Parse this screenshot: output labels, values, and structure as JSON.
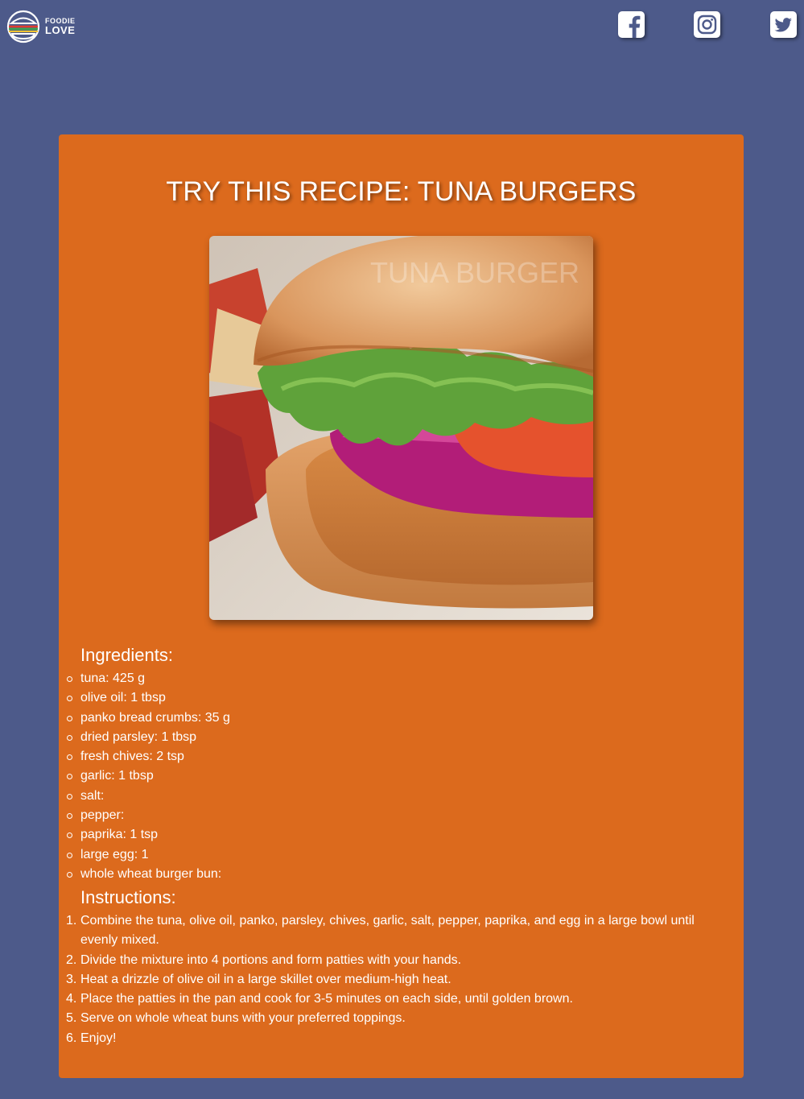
{
  "header": {
    "logo_top": "FOODIE",
    "logo_bottom": "LOVE",
    "social": [
      {
        "name": "facebook",
        "icon": "facebook-icon"
      },
      {
        "name": "instagram",
        "icon": "instagram-icon"
      },
      {
        "name": "twitter",
        "icon": "twitter-icon"
      }
    ]
  },
  "colors": {
    "background": "#4d5a8a",
    "card": "#dc6a1d",
    "text": "#ffffff"
  },
  "recipe": {
    "title": "TRY THIS RECIPE: TUNA BURGERS",
    "image_watermark": "TUNA BURGER",
    "ingredients_heading": "Ingredients:",
    "ingredients": [
      "tuna: 425 g",
      "olive oil: 1 tbsp",
      "panko bread crumbs: 35 g",
      "dried parsley: 1 tbsp",
      "fresh chives: 2 tsp",
      "garlic: 1 tbsp",
      "salt:",
      "pepper:",
      "paprika: 1 tsp",
      "large egg: 1",
      "whole wheat burger bun:"
    ],
    "instructions_heading": "Instructions:",
    "instructions": [
      "Combine the tuna, olive oil, panko, parsley, chives, garlic, salt, pepper, paprika, and egg in a large bowl until evenly mixed.",
      "Divide the mixture into 4 portions and form patties with your hands.",
      "Heat a drizzle of olive oil in a large skillet over medium-high heat.",
      "Place the patties in the pan and cook for 3-5 minutes on each side, until golden brown.",
      "Serve on whole wheat buns with your preferred toppings.",
      "Enjoy!"
    ]
  }
}
